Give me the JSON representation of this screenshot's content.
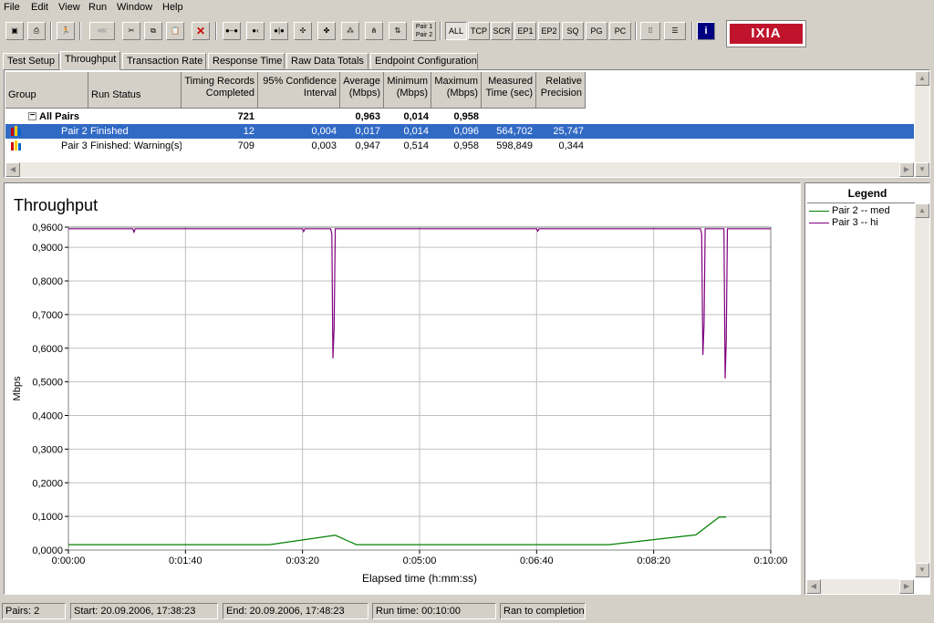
{
  "menu": [
    "File",
    "Edit",
    "View",
    "Run",
    "Window",
    "Help"
  ],
  "toolbar": {
    "pair_label_1": "Pair 1",
    "pair_label_2": "Pair 2",
    "filters": [
      "ALL",
      "TCP",
      "SCR",
      "EP1",
      "EP2",
      "SQ",
      "PG",
      "PC"
    ],
    "logo_text": "IXIA"
  },
  "tabs": [
    "Test Setup",
    "Throughput",
    "Transaction Rate",
    "Response Time",
    "Raw Data Totals",
    "Endpoint Configuration"
  ],
  "active_tab": "Throughput",
  "table": {
    "headers": {
      "group": "Group",
      "run_status": "Run Status",
      "timing_records_1": "Timing Records",
      "timing_records_2": "Completed",
      "confidence_1": "95% Confidence",
      "confidence_2": "Interval",
      "average_1": "Average",
      "average_2": "(Mbps)",
      "minimum_1": "Minimum",
      "minimum_2": "(Mbps)",
      "maximum_1": "Maximum",
      "maximum_2": "(Mbps)",
      "measured_1": "Measured",
      "measured_2": "Time (sec)",
      "relative_1": "Relative",
      "relative_2": "Precision"
    },
    "summary": {
      "expander": "−",
      "group": "All Pairs",
      "records": "721",
      "average": "0,963",
      "minimum": "0,014",
      "maximum": "0,958"
    },
    "rows": [
      {
        "group": "Pair 2",
        "status": "Finished",
        "records": "12",
        "confidence": "0,004",
        "average": "0,017",
        "minimum": "0,014",
        "maximum": "0,096",
        "time": "564,702",
        "precision": "25,747",
        "selected": true
      },
      {
        "group": "Pair 3",
        "status": "Finished: Warning(s)",
        "records": "709",
        "confidence": "0,003",
        "average": "0,947",
        "minimum": "0,514",
        "maximum": "0,958",
        "time": "598,849",
        "precision": "0,344",
        "selected": false
      }
    ]
  },
  "chart_data": {
    "type": "line",
    "title": "Throughput",
    "xlabel": "Elapsed time (h:mm:ss)",
    "ylabel": "Mbps",
    "xlim": [
      0,
      600
    ],
    "ylim": [
      0,
      0.96
    ],
    "x_ticks": [
      "0:00:00",
      "0:01:40",
      "0:03:20",
      "0:05:00",
      "0:06:40",
      "0:08:20",
      "0:10:00"
    ],
    "x_tick_values": [
      0,
      100,
      200,
      300,
      400,
      500,
      600
    ],
    "y_ticks": [
      "0,0000",
      "0,1000",
      "0,2000",
      "0,3000",
      "0,4000",
      "0,5000",
      "0,6000",
      "0,7000",
      "0,8000",
      "0,9000",
      "0,9600"
    ],
    "y_tick_values": [
      0,
      0.1,
      0.2,
      0.3,
      0.4,
      0.5,
      0.6,
      0.7,
      0.8,
      0.9,
      0.96
    ],
    "grid": true,
    "series": [
      {
        "name": "Pair 2 -- med",
        "color": "#008000",
        "x": [
          0,
          172,
          228,
          246,
          462,
          536,
          556,
          562
        ],
        "y": [
          0.016,
          0.016,
          0.044,
          0.016,
          0.016,
          0.045,
          0.098,
          0.098
        ]
      },
      {
        "name": "Pair 3 -- hi",
        "color": "#800080",
        "x": [
          0,
          55,
          56,
          57,
          200,
          201,
          202,
          205,
          224,
          225,
          226,
          227,
          228,
          229,
          400,
          401,
          402,
          540,
          541,
          542,
          543,
          544,
          545,
          560,
          561,
          562,
          563,
          600
        ],
        "y": [
          0.955,
          0.955,
          0.945,
          0.955,
          0.955,
          0.947,
          0.955,
          0.955,
          0.955,
          0.94,
          0.57,
          0.66,
          0.955,
          0.955,
          0.955,
          0.948,
          0.955,
          0.955,
          0.94,
          0.58,
          0.67,
          0.955,
          0.955,
          0.955,
          0.51,
          0.62,
          0.955,
          0.955
        ]
      }
    ],
    "legend_title": "Legend",
    "legend_position": "right-panel"
  },
  "status_bar": {
    "pairs": "Pairs: 2",
    "start": "Start: 20.09.2006, 17:38:23",
    "end": "End: 20.09.2006, 17:48:23",
    "run_time": "Run time: 00:10:00",
    "completion": "Ran to completion"
  }
}
